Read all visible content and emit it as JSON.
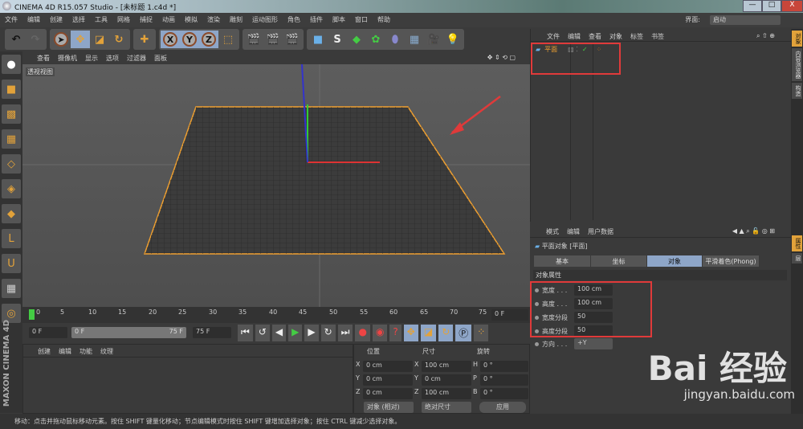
{
  "title": "CINEMA 4D R15.057 Studio - [未标题 1.c4d *]",
  "window_buttons": {
    "minimize": "—",
    "maximize": "□",
    "close": "X"
  },
  "menu": [
    "文件",
    "编辑",
    "创建",
    "选择",
    "工具",
    "网格",
    "捕捉",
    "动画",
    "模拟",
    "渲染",
    "雕刻",
    "运动图形",
    "角色",
    "插件",
    "脚本",
    "窗口",
    "帮助"
  ],
  "layout": {
    "label": "界面:",
    "value": "启动"
  },
  "viewport": {
    "menu": [
      "查看",
      "摄像机",
      "显示",
      "选项",
      "过滤器",
      "面板"
    ],
    "label": "透视视图"
  },
  "timeline": {
    "ticks": [
      "0",
      "5",
      "10",
      "15",
      "20",
      "25",
      "30",
      "35",
      "40",
      "45",
      "50",
      "55",
      "60",
      "65",
      "70",
      "75"
    ],
    "current": "0 F"
  },
  "controls": {
    "start": "0 F",
    "range_start": "0 F",
    "range_end": "75 F",
    "end": "75 F"
  },
  "material": {
    "menu": [
      "创建",
      "编辑",
      "功能",
      "纹理"
    ]
  },
  "coords": {
    "headers": [
      "位置",
      "尺寸",
      "旋转"
    ],
    "rows": [
      {
        "a": "X",
        "pos": "0 cm",
        "b": "X",
        "size": "100 cm",
        "c": "H",
        "rot": "0 °"
      },
      {
        "a": "Y",
        "pos": "0 cm",
        "b": "Y",
        "size": "0 cm",
        "c": "P",
        "rot": "0 °"
      },
      {
        "a": "Z",
        "pos": "0 cm",
        "b": "Z",
        "size": "100 cm",
        "c": "B",
        "rot": "0 °"
      }
    ],
    "mode": "对象 (相对)",
    "size_mode": "绝对尺寸",
    "apply": "应用"
  },
  "objects": {
    "menu": [
      "文件",
      "编辑",
      "查看",
      "对象",
      "标签",
      "书签"
    ],
    "items": [
      {
        "name": "平面"
      }
    ]
  },
  "attributes": {
    "menu": [
      "模式",
      "编辑",
      "用户数据"
    ],
    "object_title": "平面对象 [平面]",
    "tabs": [
      "基本",
      "坐标",
      "对象",
      "平滑着色(Phong)"
    ],
    "active_tab": "对象",
    "section": "对象属性",
    "props": [
      {
        "label": "宽度 . . .",
        "value": "100 cm"
      },
      {
        "label": "高度 . . .",
        "value": "100 cm"
      },
      {
        "label": "宽度分段",
        "value": "50"
      },
      {
        "label": "高度分段",
        "value": "50"
      },
      {
        "label": "方向 . . .",
        "value": "+Y"
      }
    ]
  },
  "right_tabs": [
    "对象",
    "内容浏览器",
    "构造"
  ],
  "attr_tabs": [
    "属性",
    "层"
  ],
  "status": "移动：点击并拖动鼠标移动元素。按住 SHIFT 键量化移动；节点编辑模式时按住 SHIFT 键增加选择对象；按住 CTRL 键减少选择对象。",
  "brand": "MAXON CINEMA 4D",
  "watermark": {
    "main": "Bai 经验",
    "url": "jingyan.baidu.com"
  },
  "colors": {
    "accent": "#8ea6c8",
    "highlight": "#e03a3a",
    "selection": "#f0a030"
  }
}
